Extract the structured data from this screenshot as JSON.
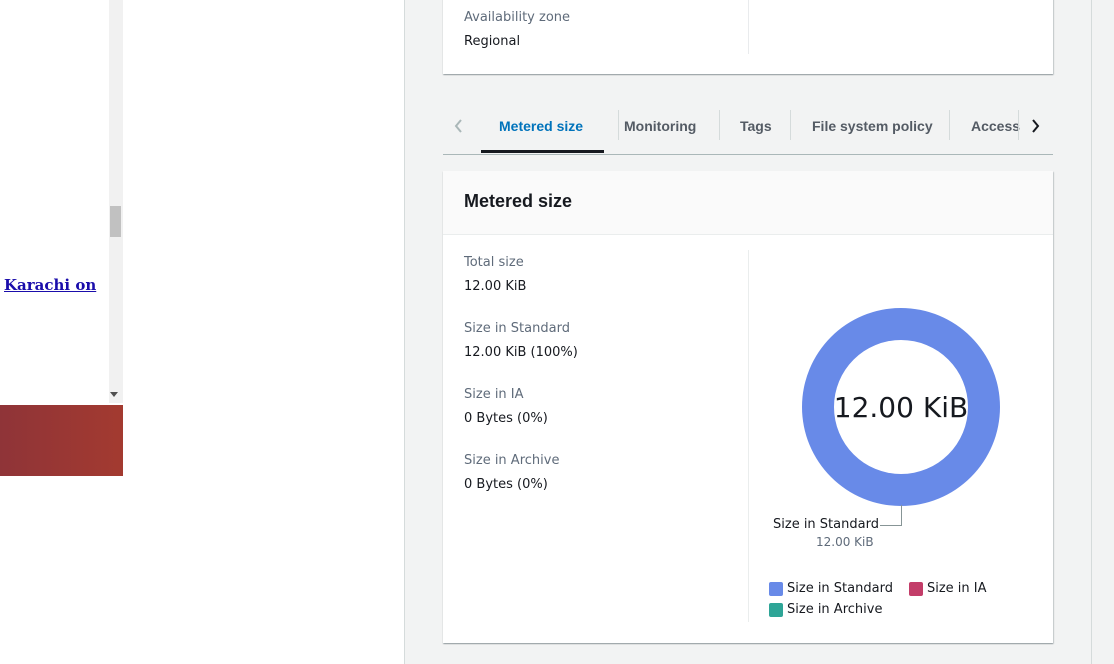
{
  "background_page": {
    "link_text": "Karachi on"
  },
  "summary_card": {
    "availability_zone_label": "Availability zone",
    "availability_zone_value": "Regional"
  },
  "tabs": [
    {
      "label": "Metered size",
      "active": true
    },
    {
      "label": "Monitoring",
      "active": false
    },
    {
      "label": "Tags",
      "active": false
    },
    {
      "label": "File system policy",
      "active": false
    },
    {
      "label": "Access",
      "active": false
    }
  ],
  "metered_size": {
    "title": "Metered size",
    "stats": [
      {
        "label": "Total size",
        "value": "12.00 KiB"
      },
      {
        "label": "Size in Standard",
        "value": "12.00 KiB (100%)"
      },
      {
        "label": "Size in IA",
        "value": "0 Bytes (0%)"
      },
      {
        "label": "Size in Archive",
        "value": "0 Bytes (0%)"
      }
    ],
    "donut_center": "12.00 KiB",
    "callout_title": "Size in Standard",
    "callout_value": "12.00 KiB"
  },
  "chart_data": {
    "type": "pie",
    "categories": [
      "Size in Standard",
      "Size in IA",
      "Size in Archive"
    ],
    "values": [
      12.0,
      0,
      0
    ],
    "unit": "KiB",
    "colors": [
      "#688ae8",
      "#c33d69",
      "#2ea597"
    ],
    "legend": "bottom-left"
  },
  "legend": [
    {
      "label": "Size in Standard",
      "color": "#688ae8"
    },
    {
      "label": "Size in IA",
      "color": "#c33d69"
    },
    {
      "label": "Size in Archive",
      "color": "#2ea597"
    }
  ],
  "icons": {
    "tab_prev": "chevron-left-icon",
    "tab_next": "chevron-right-icon"
  }
}
